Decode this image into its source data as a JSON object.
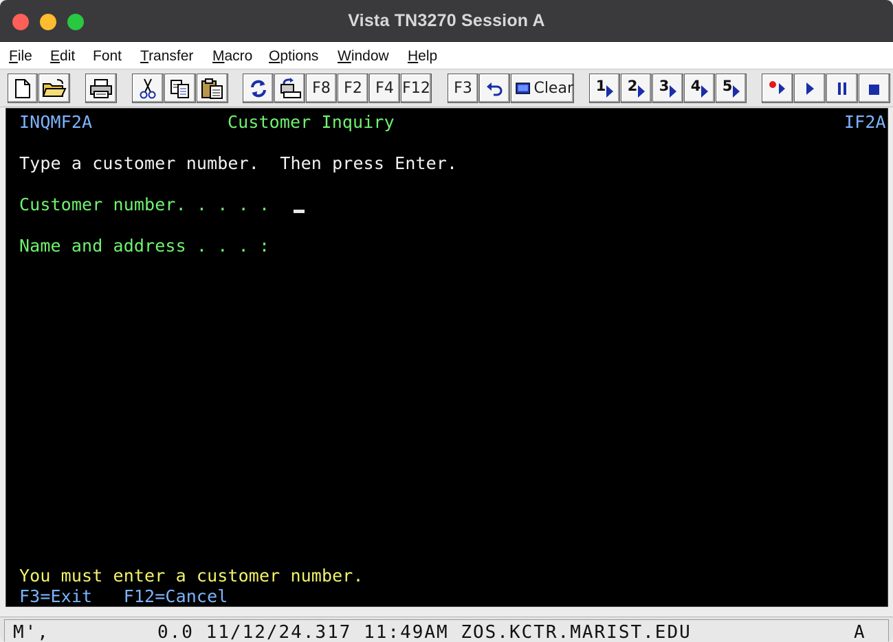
{
  "window": {
    "title": "Vista TN3270 Session A"
  },
  "menu": [
    {
      "label": "File",
      "key": "F",
      "rest": "ile"
    },
    {
      "label": "Edit",
      "key": "E",
      "rest": "dit"
    },
    {
      "label": "Font",
      "key": "",
      "rest": "Font"
    },
    {
      "label": "Transfer",
      "key": "T",
      "rest": "ransfer"
    },
    {
      "label": "Macro",
      "key": "M",
      "rest": "acro"
    },
    {
      "label": "Options",
      "key": "O",
      "rest": "ptions"
    },
    {
      "label": "Window",
      "key": "W",
      "rest": "indow"
    },
    {
      "label": "Help",
      "key": "H",
      "rest": "elp"
    }
  ],
  "toolbar": {
    "f8": "F8",
    "f2": "F2",
    "f4": "F4",
    "f12": "F12",
    "f3": "F3",
    "clear": "Clear",
    "macro1": "1",
    "macro2": "2",
    "macro3": "3",
    "macro4": "4",
    "macro5": "5",
    "icons": [
      "new-file-icon",
      "open-folder-icon",
      "print-icon",
      "cut-icon",
      "copy-icon",
      "paste-icon",
      "refresh-icon",
      "transfer-icon",
      "undo-icon",
      "clear-icon",
      "record-icon",
      "play-icon",
      "pause-icon",
      "stop-icon"
    ]
  },
  "screen": {
    "program_id": "INQMF2A",
    "screen_title": "Customer Inquiry",
    "screen_id": "IF2A",
    "instruction": "Type a customer number.  Then press Enter.",
    "customer_number_label": "Customer number. . . . .",
    "name_address_label": "Name and address . . . :",
    "message": "You must enter a customer number.",
    "function_keys": "F3=Exit   F12=Cancel",
    "colors": {
      "background": "#000000",
      "header": "#7cb4ff",
      "field_label": "#6ff36f",
      "text": "#f2f2f2",
      "message": "#f2f26a"
    }
  },
  "status": {
    "left": "M',",
    "middle": "0.0 11/12/24.317 11:49AM ZOS.KCTR.MARIST.EDU",
    "right": "A"
  }
}
